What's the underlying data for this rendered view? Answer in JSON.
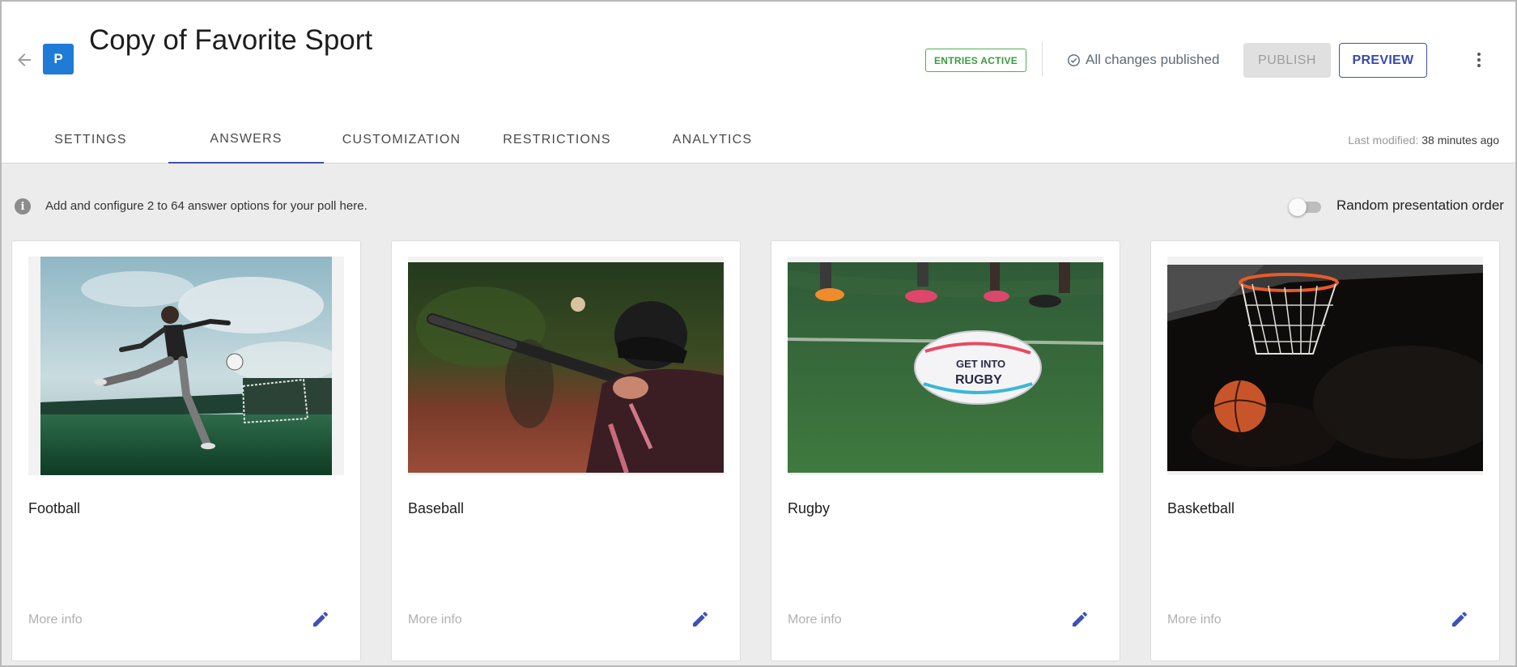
{
  "header": {
    "title": "Copy of Favorite Sport",
    "logo_letter": "P",
    "entries_badge": "ENTRIES ACTIVE",
    "published_status": "All changes published",
    "publish_label": "PUBLISH",
    "preview_label": "PREVIEW"
  },
  "tabs": [
    {
      "label": "SETTINGS",
      "active": false
    },
    {
      "label": "ANSWERS",
      "active": true
    },
    {
      "label": "CUSTOMIZATION",
      "active": false
    },
    {
      "label": "RESTRICTIONS",
      "active": false
    },
    {
      "label": "ANALYTICS",
      "active": false
    }
  ],
  "last_modified": {
    "label": "Last modified:",
    "value": "38 minutes ago"
  },
  "info": {
    "text": "Add and configure 2 to 64 answer options for your poll here.",
    "icon_glyph": "i"
  },
  "random_order": {
    "label": "Random presentation order",
    "enabled": false
  },
  "answers": [
    {
      "name": "Football",
      "more_info": "More info",
      "image": "football-photo"
    },
    {
      "name": "Baseball",
      "more_info": "More info",
      "image": "baseball-photo"
    },
    {
      "name": "Rugby",
      "more_info": "More info",
      "image": "rugby-photo"
    },
    {
      "name": "Basketball",
      "more_info": "More info",
      "image": "basketball-photo"
    }
  ],
  "colors": {
    "brand": "#1f7bd6",
    "accent": "#3f51b5",
    "badge_green": "#4caf50"
  }
}
